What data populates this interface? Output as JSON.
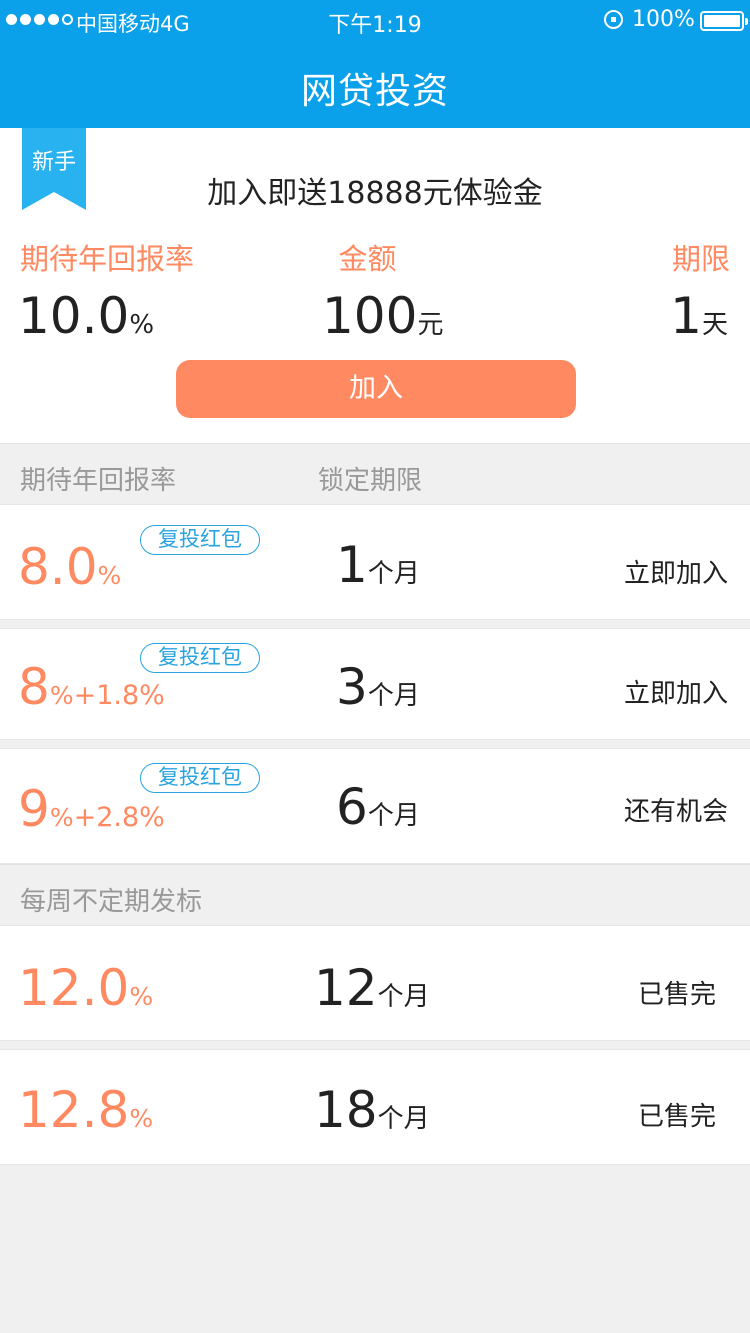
{
  "status_bar": {
    "carrier": "中国移动4G",
    "time": "下午1:19",
    "battery": "100%",
    "signal_bars_filled": 4,
    "signal_bars_total": 5
  },
  "nav": {
    "title": "网贷投资"
  },
  "newbie": {
    "ribbon": "新手",
    "promo": "加入即送18888元体验金",
    "rate_label": "期待年回报率",
    "amount_label": "金额",
    "term_label": "期限",
    "rate_value": "10.0",
    "rate_unit": "%",
    "amount_value": "100",
    "amount_unit": "元",
    "term_value": "1",
    "term_unit": "天",
    "join_button": "加入"
  },
  "section1": {
    "col_rate": "期待年回报率",
    "col_term": "锁定期限",
    "rows": [
      {
        "rate": "8.0",
        "rate_unit": "%",
        "bonus": "",
        "badge": "复投红包",
        "term": "1",
        "term_unit": "个月",
        "action": "立即加入"
      },
      {
        "rate": "8",
        "rate_unit": "%",
        "bonus": "+1.8%",
        "badge": "复投红包",
        "term": "3",
        "term_unit": "个月",
        "action": "立即加入"
      },
      {
        "rate": "9",
        "rate_unit": "%",
        "bonus": "+2.8%",
        "badge": "复投红包",
        "term": "6",
        "term_unit": "个月",
        "action": "还有机会"
      }
    ]
  },
  "section2": {
    "title": "每周不定期发标",
    "rows": [
      {
        "rate": "12.0",
        "rate_unit": "%",
        "term": "12",
        "term_unit": "个月",
        "action": "已售完"
      },
      {
        "rate": "12.8",
        "rate_unit": "%",
        "term": "18",
        "term_unit": "个月",
        "action": "已售完"
      }
    ]
  },
  "colors": {
    "primary_blue": "#0aa0ea",
    "accent_orange": "#ff8a62",
    "badge_blue": "#2aa3e0",
    "background": "#f0f0f0"
  },
  "icons": [
    "signal-icon",
    "orientation-lock-icon",
    "battery-icon",
    "ribbon-icon"
  ]
}
